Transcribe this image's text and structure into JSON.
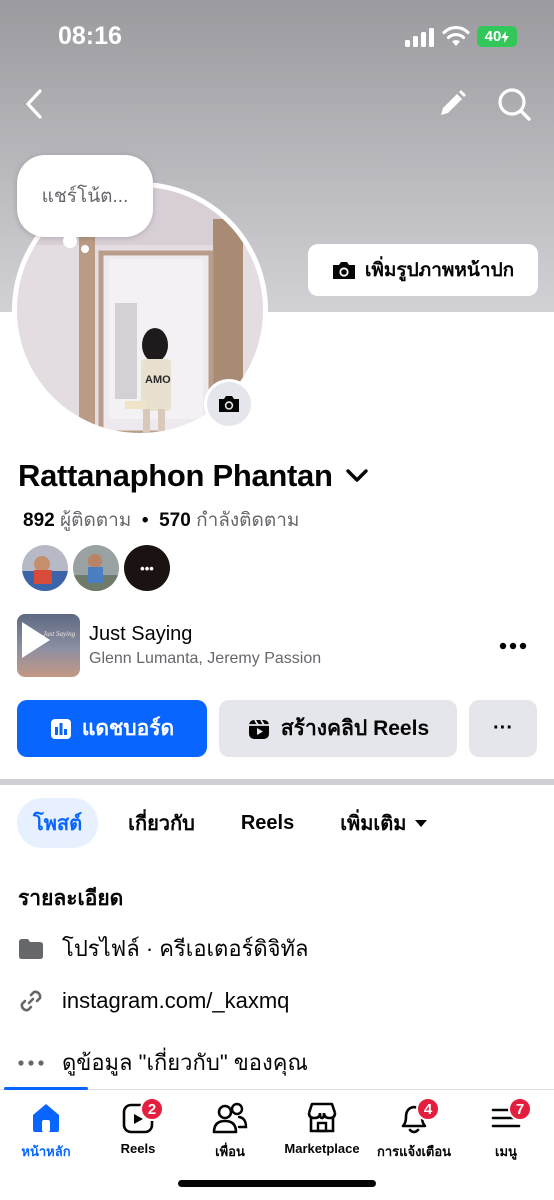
{
  "status": {
    "time": "08:16",
    "battery": "40"
  },
  "topnav": {
    "back_icon": "chevron-left-icon",
    "edit_icon": "pencil-icon",
    "search_icon": "search-icon"
  },
  "note": {
    "placeholder": "แชร์โน้ต..."
  },
  "cover_button": {
    "label": "เพิ่มรูปภาพหน้าปก",
    "icon": "camera-icon"
  },
  "profile": {
    "name": "Rattanaphon Phantan",
    "followers_count": "892",
    "followers_label": "ผู้ติดตาม",
    "separator": "•",
    "following_count": "570",
    "following_label": "กำลังติดตาม"
  },
  "friends_preview": {
    "more_label": "•••"
  },
  "music": {
    "title": "Just Saying",
    "artist": "Glenn Lumanta, Jeremy Passion",
    "art_text": "Just Saying"
  },
  "actions": {
    "dashboard_label": "แดชบอร์ด",
    "create_reels_label": "สร้างคลิป Reels",
    "more_label": "···"
  },
  "tabs": [
    {
      "label": "โพสต์",
      "active": true
    },
    {
      "label": "เกี่ยวกับ",
      "active": false
    },
    {
      "label": "Reels",
      "active": false
    },
    {
      "label": "เพิ่มเติม",
      "active": false
    }
  ],
  "details": {
    "title": "รายละเอียด",
    "items": [
      {
        "icon": "profile-page-icon",
        "text": "โปรไฟล์ · ครีเอเตอร์ดิจิทัล"
      },
      {
        "icon": "link-icon",
        "text": "instagram.com/_kaxmq"
      },
      {
        "icon": "more-icon",
        "text": "ดูข้อมูล \"เกี่ยวกับ\" ของคุณ"
      }
    ]
  },
  "bottom_nav": [
    {
      "label": "หน้าหลัก",
      "icon": "home-icon",
      "badge": "",
      "active": true
    },
    {
      "label": "Reels",
      "icon": "reels-icon",
      "badge": "2",
      "active": false
    },
    {
      "label": "เพื่อน",
      "icon": "friends-icon",
      "badge": "",
      "active": false
    },
    {
      "label": "Marketplace",
      "icon": "marketplace-icon",
      "badge": "",
      "active": false
    },
    {
      "label": "การแจ้งเตือน",
      "icon": "bell-icon",
      "badge": "4",
      "active": false
    },
    {
      "label": "เมนู",
      "icon": "menu-icon",
      "badge": "7",
      "active": false
    }
  ],
  "colors": {
    "accent": "#0866ff",
    "badge": "#e41e3f",
    "secondary_bg": "#e4e6eb",
    "active_tab_bg": "#e7f0ff"
  }
}
